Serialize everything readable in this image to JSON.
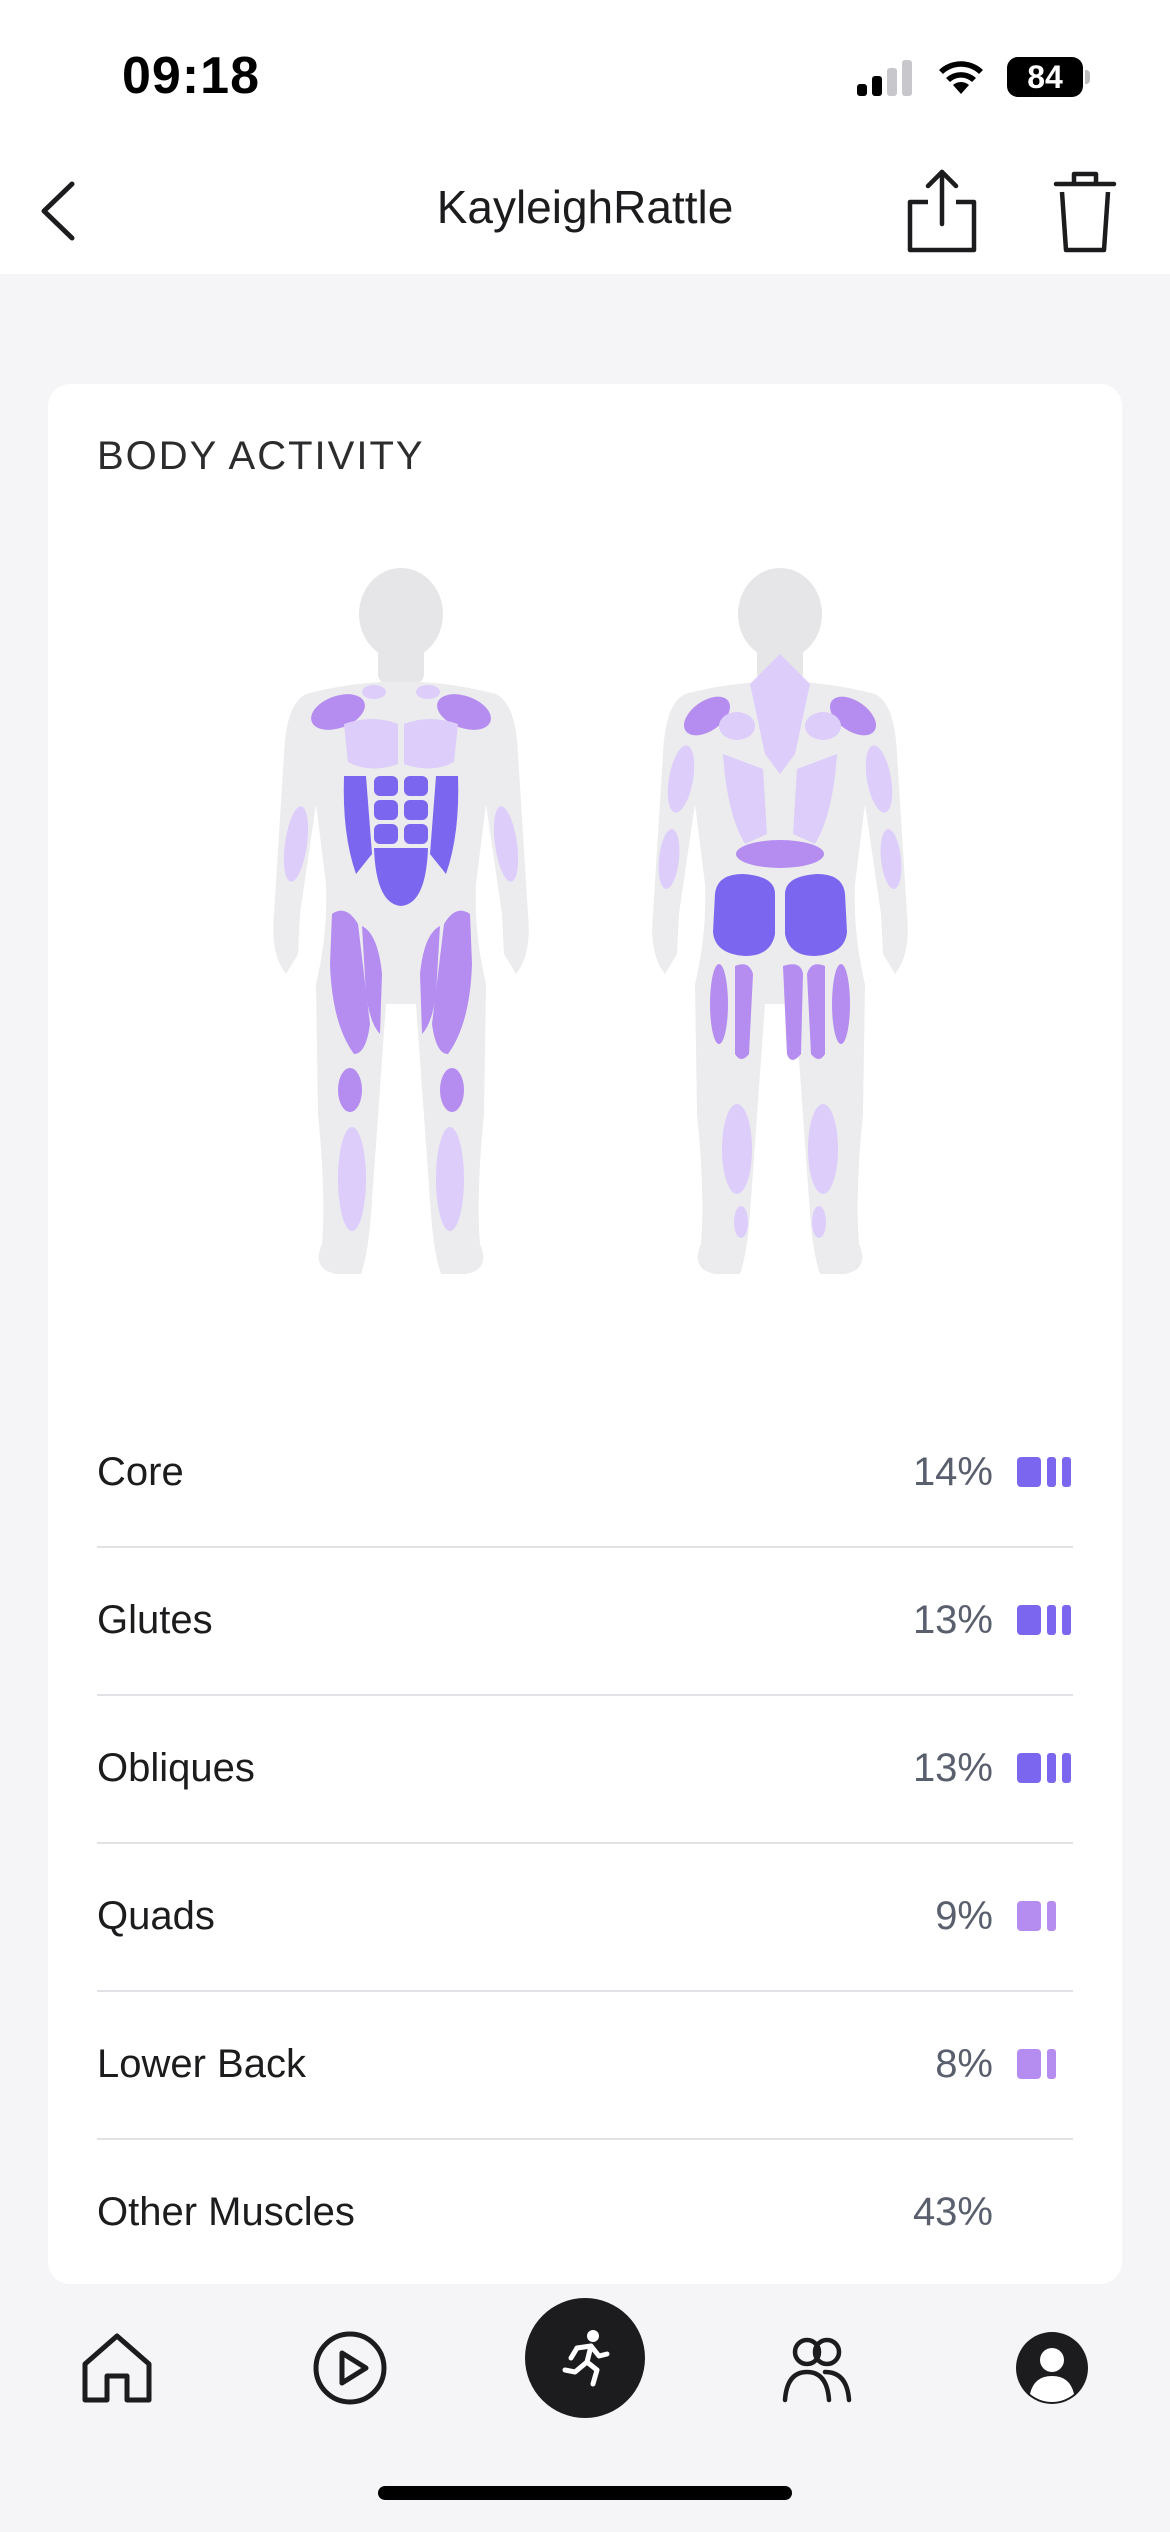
{
  "status_bar": {
    "time": "09:18",
    "battery": "84"
  },
  "header": {
    "title": "KayleighRattle",
    "back_icon": "chevron-left-icon",
    "share_icon": "share-icon",
    "delete_icon": "trash-icon"
  },
  "card": {
    "title": "BODY ACTIVITY",
    "muscles": [
      {
        "name": "Core",
        "percent": "14%",
        "intensity": 3
      },
      {
        "name": "Glutes",
        "percent": "13%",
        "intensity": 3
      },
      {
        "name": "Obliques",
        "percent": "13%",
        "intensity": 3
      },
      {
        "name": "Quads",
        "percent": "9%",
        "intensity": 1
      },
      {
        "name": "Lower Back",
        "percent": "8%",
        "intensity": 1
      },
      {
        "name": "Other Muscles",
        "percent": "43%",
        "intensity": 0
      }
    ]
  },
  "colors": {
    "high": "#7b66f0",
    "medium": "#b58cf0",
    "low": "#dccdfa",
    "body": "#ececee",
    "head": "#e6e6e8"
  },
  "tab_bar": {
    "items": [
      "home-icon",
      "play-icon",
      "workout-icon",
      "friends-icon",
      "profile-icon"
    ]
  }
}
